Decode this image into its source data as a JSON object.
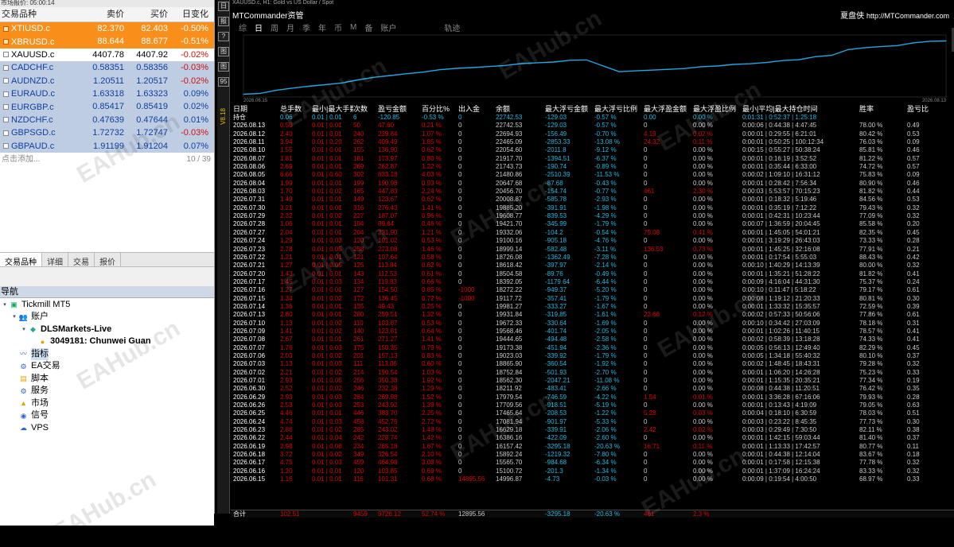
{
  "market_watch": {
    "title": "市场报价: 05:00:14",
    "headers": {
      "symbol": "交易品种",
      "bid": "卖价",
      "ask": "买价",
      "change": "日变化"
    },
    "rows": [
      {
        "symbol": "XTIUSD.c",
        "bid": "82.370",
        "ask": "82.403",
        "change": "-0.50%",
        "style": "orange"
      },
      {
        "symbol": "XBRUSD.c",
        "bid": "88.644",
        "ask": "88.677",
        "change": "-0.51%",
        "style": "orange"
      },
      {
        "symbol": "XAUUSD.c",
        "bid": "4407.78",
        "ask": "4407.92",
        "change": "-0.02%",
        "style": "white"
      },
      {
        "symbol": "CADCHF.c",
        "bid": "0.58351",
        "ask": "0.58356",
        "change": "-0.03%",
        "style": "blue"
      },
      {
        "symbol": "AUDNZD.c",
        "bid": "1.20511",
        "ask": "1.20517",
        "change": "-0.02%",
        "style": "blue"
      },
      {
        "symbol": "EURAUD.c",
        "bid": "1.63318",
        "ask": "1.63323",
        "change": "0.09%",
        "style": "blue"
      },
      {
        "symbol": "EURGBP.c",
        "bid": "0.85417",
        "ask": "0.85419",
        "change": "0.02%",
        "style": "blue"
      },
      {
        "symbol": "NZDCHF.c",
        "bid": "0.47639",
        "ask": "0.47644",
        "change": "0.01%",
        "style": "blue"
      },
      {
        "symbol": "GBPSGD.c",
        "bid": "1.72732",
        "ask": "1.72747",
        "change": "-0.03%",
        "style": "blue"
      },
      {
        "symbol": "GBPAUD.c",
        "bid": "1.91199",
        "ask": "1.91204",
        "change": "0.07%",
        "style": "blue"
      }
    ],
    "add_label": "点击添加...",
    "count": "10 / 39",
    "tabs": [
      "交易品种",
      "详细",
      "交易",
      "报价"
    ]
  },
  "navigator": {
    "title": "导航",
    "items": [
      {
        "label": "Tickmill MT5",
        "indent": 0,
        "icon": "terminal-icon",
        "bold": false
      },
      {
        "label": "账户",
        "indent": 1,
        "icon": "accounts-icon",
        "bold": false
      },
      {
        "label": "DLSMarkets-Live",
        "indent": 2,
        "icon": "server-icon",
        "bold": true
      },
      {
        "label": "3049181: Chunwei Guan",
        "indent": 3,
        "icon": "user-icon",
        "bold": true
      },
      {
        "label": "指标",
        "indent": 1,
        "icon": "indicators-icon",
        "bold": false,
        "selected": true
      },
      {
        "label": "EA交易",
        "indent": 1,
        "icon": "expert-advisor-icon",
        "bold": false
      },
      {
        "label": "脚本",
        "indent": 1,
        "icon": "scripts-icon",
        "bold": false
      },
      {
        "label": "服务",
        "indent": 1,
        "icon": "services-icon",
        "bold": false
      },
      {
        "label": "市场",
        "indent": 1,
        "icon": "market-icon",
        "bold": false
      },
      {
        "label": "信号",
        "indent": 1,
        "icon": "signals-icon",
        "bold": false
      },
      {
        "label": "VPS",
        "indent": 1,
        "icon": "vps-icon",
        "bold": false
      }
    ]
  },
  "chart_window": {
    "title": "XAUUSD.c, H1: Gold vs US Dollar / Spot",
    "app_name": "MTCommander资管",
    "brand": "夏盘侠",
    "brand_url": "http://MTCommander.com",
    "tabs": [
      "综",
      "日",
      "周",
      "月",
      "季",
      "年",
      "币",
      "M",
      "备",
      "账户"
    ],
    "active_tab": "日",
    "trail_label": "轨迹",
    "version_label": "V8.18",
    "axis_start": "2026.06.15",
    "axis_end": "2026.08.13",
    "toolbar_labels": [
      "日",
      "报",
      "?",
      "图",
      "图",
      "95"
    ]
  },
  "chart_data": {
    "type": "line",
    "title": "",
    "xlabel": "",
    "ylabel": "",
    "x": [
      "2026.06.15",
      "2026.06.16",
      "2026.06.17",
      "2026.06.18",
      "2026.06.19",
      "2026.06.22",
      "2026.06.23",
      "2026.06.24",
      "2026.06.25",
      "2026.06.26",
      "2026.06.29",
      "2026.06.30",
      "2026.07.01",
      "2026.07.02",
      "2026.07.03",
      "2026.07.06",
      "2026.07.07",
      "2026.07.08",
      "2026.07.09",
      "2026.07.10",
      "2026.07.13",
      "2026.07.14",
      "2026.07.15",
      "2026.07.16",
      "2026.07.17",
      "2026.07.20",
      "2026.07.21",
      "2026.07.22",
      "2026.07.23",
      "2026.07.24",
      "2026.07.27",
      "2026.07.28",
      "2026.07.29",
      "2026.07.30",
      "2026.07.31",
      "2026.08.03",
      "2026.08.04",
      "2026.08.05",
      "2026.08.06",
      "2026.08.07",
      "2026.08.10",
      "2026.08.11",
      "2026.08.12",
      "2026.08.13"
    ],
    "series": [
      {
        "values": [
          14996.87,
          15100.72,
          15565.7,
          15892.24,
          16157.42,
          16386.16,
          16629.18,
          17081.94,
          17465.64,
          17709.56,
          17979.54,
          18211.92,
          18562.3,
          18752.84,
          18865.9,
          19023.03,
          19173.38,
          19444.65,
          19568.46,
          19672.33,
          19931.84,
          19981.27,
          19117.72,
          18272.22,
          18392.05,
          18504.58,
          18618.42,
          18726.08,
          18999.14,
          19100.16,
          19332.06,
          19421.7,
          19608.77,
          19885.2,
          20008.87,
          20456.7,
          20647.68,
          21480.86,
          21743.73,
          21917.7,
          22054.6,
          22465.09,
          22694.93,
          22742.53
        ]
      }
    ],
    "color": "#22a8e0"
  },
  "table": {
    "headers": [
      "日期",
      "总手数",
      "最小|最大手数",
      "次数",
      "盈亏金额",
      "百分比%",
      "出入金",
      "余额",
      "最大浮亏金额",
      "最大浮亏比例",
      "最大浮盈金额",
      "最大浮盈比例",
      "最小|平均|最大持仓时间",
      "胜率",
      "盈亏比"
    ],
    "hold_row": [
      "持仓",
      "0.06",
      "0.01 | 0.01",
      "6",
      "-120.85",
      "-0.53 %",
      "0",
      "22742.53",
      "-129.03",
      "-0.57 %",
      "0.00",
      "0.00 %",
      "0:01:31 | 0:52:37 | 1:25:18",
      "",
      ""
    ],
    "rows": [
      [
        "2026.08.13",
        "0.50",
        "0.01 | 0.01",
        "50",
        "47.60",
        "0.21 %",
        "0",
        "22742.53",
        "-129.03",
        "-0.57 %",
        "0",
        "0.00 %",
        "0:00:06 | 0:44:38 | 4:47:45",
        "78.00 %",
        "0.49"
      ],
      [
        "2026.08.12",
        "2.40",
        "0.01 | 0.01",
        "240",
        "239.84",
        "1.07 %",
        "0",
        "22694.93",
        "-156.49",
        "-0.70 %",
        "4.19",
        "0.02 %",
        "0:00:01 | 0:29:55 | 6:21:01",
        "80.42 %",
        "0.53"
      ],
      [
        "2026.08.11",
        "3.94",
        "0.01 | 0.20",
        "262",
        "409.49",
        "1.85 %",
        "0",
        "22465.09",
        "-2853.33",
        "-13.08 %",
        "24.32",
        "0.11 %",
        "0:00:01 | 0:50:25 | 100:12:34",
        "76.03 %",
        "0.09"
      ],
      [
        "2026.08.10",
        "1.55",
        "0.01 | 0.01",
        "155",
        "136.90",
        "0.62 %",
        "0",
        "22054.60",
        "-2011.8",
        "-9.12 %",
        "0",
        "0.00 %",
        "0:00:15 | 0:55:27 | 50:38:24",
        "85.81 %",
        "0.46"
      ],
      [
        "2026.08.07",
        "1.81",
        "0.01 | 0.01",
        "181",
        "173.97",
        "0.80 %",
        "0",
        "21917.70",
        "-1394.51",
        "-6.37 %",
        "0",
        "0.00 %",
        "0:00:01 | 0:16:19 | 3:52:52",
        "81.22 %",
        "0.57"
      ],
      [
        "2026.08.06",
        "2.69",
        "0.01 | 0.01",
        "269",
        "262.87",
        "1.22 %",
        "0",
        "21743.73",
        "-190.74",
        "-0.89 %",
        "0",
        "0.00 %",
        "0:00:01 | 0:35:44 | 6:33:00",
        "74.72 %",
        "0.57"
      ],
      [
        "2026.08.05",
        "6.66",
        "0.01 | 0.60",
        "302",
        "833.18",
        "4.03 %",
        "0",
        "21480.86",
        "-2510.39",
        "-11.53 %",
        "0",
        "0.00 %",
        "0:00:02 | 1:09:10 | 16:31:12",
        "75.83 %",
        "0.09"
      ],
      [
        "2026.08.04",
        "1.99",
        "0.01 | 0.01",
        "199",
        "190.98",
        "0.93 %",
        "0",
        "20647.68",
        "-87.68",
        "-0.43 %",
        "0",
        "0.00 %",
        "0:00:01 | 0:28:42 | 7:56:34",
        "80.90 %",
        "0.46"
      ],
      [
        "2026.08.03",
        "1.70",
        "0.01 | 0.02",
        "165",
        "447.83",
        "2.24 %",
        "0",
        "20456.70",
        "-154.74",
        "-0.77 %",
        "461",
        "2.30 %",
        "0:00:03 | 5:53:57 | 70:15:23",
        "81.82 %",
        "0.44"
      ],
      [
        "2026.07.31",
        "1.49",
        "0.01 | 0.01",
        "149",
        "123.67",
        "0.62 %",
        "0",
        "20008.87",
        "-585.78",
        "-2.93 %",
        "0",
        "0.00 %",
        "0:00:01 | 0:18:32 | 5:19:46",
        "84.56 %",
        "0.53"
      ],
      [
        "2026.07.30",
        "3.21",
        "0.01 | 0.01",
        "316",
        "276.43",
        "1.41 %",
        "0",
        "19885.20",
        "-391.91",
        "-1.98 %",
        "0",
        "0.00 %",
        "0:00:01 | 0:35:19 | 7:12:22",
        "79.43 %",
        "0.32"
      ],
      [
        "2026.07.29",
        "2.32",
        "0.01 | 0.02",
        "227",
        "187.07",
        "0.96 %",
        "0",
        "19608.77",
        "-839.53",
        "-4.29 %",
        "0",
        "0.00 %",
        "0:00:01 | 0:42:31 | 10:23:44",
        "77.09 %",
        "0.32"
      ],
      [
        "2026.07.28",
        "1.06",
        "0.01 | 0.01",
        "104",
        "89.64",
        "0.46 %",
        "0",
        "19421.70",
        "-345.99",
        "-1.79 %",
        "0",
        "0.00 %",
        "0:00:07 | 1:36:59 | 20:04:45",
        "85.58 %",
        "0.20"
      ],
      [
        "2026.07.27",
        "2.04",
        "0.01 | 0.01",
        "204",
        "231.90",
        "1.21 %",
        "0",
        "19332.06",
        "-104.2",
        "-0.54 %",
        "79.08",
        "0.41 %",
        "0:00:01 | 1:45:05 | 54:01:21",
        "82.35 %",
        "0.45"
      ],
      [
        "2026.07.24",
        "1.29",
        "0.01 | 0.03",
        "120",
        "101.02",
        "0.53 %",
        "0",
        "19100.16",
        "-905.18",
        "-4.76 %",
        "0",
        "0.00 %",
        "0:00:01 | 3:19:29 | 26:43:03",
        "73.33 %",
        "0.28"
      ],
      [
        "2026.07.23",
        "2.78",
        "0.01 | 0.05",
        "258",
        "273.08",
        "1.46 %",
        "0",
        "18999.14",
        "-582.48",
        "-3.11 %",
        "136.53",
        "0.73 %",
        "0:00:01 | 1:45:25 | 32:16:08",
        "77.91 %",
        "0.21"
      ],
      [
        "2026.07.22",
        "1.21",
        "0.01 | 0.01",
        "121",
        "107.64",
        "0.58 %",
        "0",
        "18726.08",
        "-1362.49",
        "-7.28 %",
        "0",
        "0.00 %",
        "0:00:01 | 0:17:54 | 5:55:03",
        "88.43 %",
        "0.42"
      ],
      [
        "2026.07.21",
        "1.27",
        "0.01 | 0.05",
        "125",
        "113.84",
        "0.62 %",
        "0",
        "18618.42",
        "-397.97",
        "-2.14 %",
        "0",
        "0.00 %",
        "0:00:10 | 1:40:29 | 14:13:39",
        "80.00 %",
        "0.32"
      ],
      [
        "2026.07.20",
        "1.43",
        "0.01 | 0.01",
        "143",
        "112.53",
        "0.61 %",
        "0",
        "18504.58",
        "-89.76",
        "-0.49 %",
        "0",
        "0.00 %",
        "0:00:01 | 1:35:21 | 51:28:22",
        "81.82 %",
        "0.41"
      ],
      [
        "2026.07.17",
        "1.45",
        "0.01 | 0.03",
        "134",
        "119.83",
        "0.66 %",
        "0",
        "18392.05",
        "-1179.64",
        "-6.44 %",
        "0",
        "0.00 %",
        "0:00:09 | 4:16:04 | 44:31:30",
        "75.37 %",
        "0.24"
      ],
      [
        "2026.07.16",
        "1.27",
        "0.01 | 0.01",
        "127",
        "154.50",
        "0.85 %",
        "-1000",
        "18272.22",
        "-949.37",
        "-5.20 %",
        "0",
        "0.00 %",
        "0:00:10 | 0:11:47 | 5:18:22",
        "79.17 %",
        "0.61"
      ],
      [
        "2026.07.15",
        "1.34",
        "0.01 | 0.02",
        "172",
        "136.45",
        "0.72 %",
        "-1000",
        "19117.72",
        "-357.41",
        "-1.79 %",
        "0",
        "0.00 %",
        "0:00:08 | 1:19:12 | 21:20:33",
        "80.81 %",
        "0.30"
      ],
      [
        "2026.07.14",
        "1.36",
        "0.01 | 0.01",
        "135",
        "49.43",
        "0.25 %",
        "0",
        "19981.27",
        "-333.27",
        "-1.67 %",
        "0",
        "0.00 %",
        "0:00:01 | 1:33:32 | 15:35:57",
        "72.59 %",
        "0.39"
      ],
      [
        "2026.07.13",
        "2.80",
        "0.01 | 0.01",
        "280",
        "259.51",
        "1.32 %",
        "0",
        "19931.84",
        "-319.85",
        "-1.61 %",
        "23.68",
        "0.12 %",
        "0:00:02 | 0:57:33 | 50:56:06",
        "77.86 %",
        "0.61"
      ],
      [
        "2026.07.10",
        "1.13",
        "0.01 | 0.02",
        "110",
        "103.87",
        "0.53 %",
        "0",
        "19672.33",
        "-330.64",
        "-1.69 %",
        "0",
        "0.00 %",
        "0:00:10 | 0:34:42 | 27:03:09",
        "78.18 %",
        "0.31"
      ],
      [
        "2026.07.09",
        "1.41",
        "0.01 | 0.02",
        "140",
        "123.81",
        "0.64 %",
        "0",
        "19568.46",
        "-401.74",
        "-2.05 %",
        "0",
        "0.00 %",
        "0:00:01 | 1:02:26 | 11:40:15",
        "78.57 %",
        "0.41"
      ],
      [
        "2026.07.08",
        "2.67",
        "0.01 | 0.01",
        "261",
        "271.27",
        "1.41 %",
        "0",
        "19444.65",
        "-494.48",
        "-2.58 %",
        "0",
        "0.00 %",
        "0:00:02 | 0:58:39 | 13:18:28",
        "74.33 %",
        "0.41"
      ],
      [
        "2026.07.07",
        "1.76",
        "0.01 | 0.03",
        "175",
        "150.35",
        "0.79 %",
        "0",
        "19173.38",
        "-451.94",
        "-2.36 %",
        "0",
        "0.00 %",
        "0:00:05 | 0:56:13 | 12:49:40",
        "82.29 %",
        "0.45"
      ],
      [
        "2026.07.06",
        "2.03",
        "0.01 | 0.02",
        "201",
        "157.13",
        "0.83 %",
        "0",
        "19023.03",
        "-339.92",
        "-1.79 %",
        "0",
        "0.00 %",
        "0:00:05 | 1:34:18 | 55:40:32",
        "80.10 %",
        "0.37"
      ],
      [
        "2026.07.03",
        "1.13",
        "0.01 | 0.03",
        "111",
        "113.06",
        "0.60 %",
        "0",
        "18865.90",
        "-360.54",
        "-1.92 %",
        "0",
        "0.00 %",
        "0:00:02 | 1:48:45 | 18:43:31",
        "79.28 %",
        "0.32"
      ],
      [
        "2026.07.02",
        "2.21",
        "0.01 | 0.02",
        "214",
        "190.54",
        "1.03 %",
        "0",
        "18752.84",
        "-501.93",
        "-2.70 %",
        "0",
        "0.00 %",
        "0:00:01 | 1:06:20 | 14:26:28",
        "75.23 %",
        "0.33"
      ],
      [
        "2026.07.01",
        "2.93",
        "0.01 | 0.05",
        "256",
        "350.38",
        "1.92 %",
        "0",
        "18562.30",
        "-2047.21",
        "-11.08 %",
        "0",
        "0.00 %",
        "0:00:01 | 1:15:35 | 20:35:21",
        "77.34 %",
        "0.19"
      ],
      [
        "2026.06.30",
        "2.52",
        "0.01 | 0.02",
        "246",
        "232.38",
        "1.29 %",
        "0",
        "18211.92",
        "-483.41",
        "-2.66 %",
        "0",
        "0.00 %",
        "0:00:08 | 0:44:38 | 11:20:51",
        "76.42 %",
        "0.35"
      ],
      [
        "2026.06.29",
        "2.93",
        "0.01 | 0.03",
        "284",
        "269.98",
        "1.52 %",
        "0",
        "17979.54",
        "-746.59",
        "-4.22 %",
        "1.54",
        "0.01 %",
        "0:00:01 | 3:36:28 | 67:16:06",
        "79.93 %",
        "0.28"
      ],
      [
        "2026.06.26",
        "2.53",
        "0.01 | 0.03",
        "253",
        "243.92",
        "1.39 %",
        "0",
        "17709.56",
        "-918.51",
        "-5.19 %",
        "0",
        "0.00 %",
        "0:00:01 | 0:13:43 | 4:19:09",
        "79.05 %",
        "0.63"
      ],
      [
        "2026.06.25",
        "4.46",
        "0.01 | 0.01",
        "446",
        "383.70",
        "2.25 %",
        "0",
        "17465.64",
        "-208.53",
        "-1.22 %",
        "5.28",
        "0.03 %",
        "0:00:04 | 0:18:10 | 6:30:59",
        "78.03 %",
        "0.51"
      ],
      [
        "2026.06.24",
        "4.74",
        "0.01 | 0.03",
        "458",
        "452.76",
        "2.72 %",
        "0",
        "17081.94",
        "-901.97",
        "-5.33 %",
        "0",
        "0.00 %",
        "0:00:03 | 0:23:22 | 8:45:35",
        "77.73 %",
        "0.30"
      ],
      [
        "2026.06.23",
        "2.86",
        "0.01 | 0.02",
        "285",
        "243.02",
        "1.48 %",
        "0",
        "16629.18",
        "-339.91",
        "-2.06 %",
        "2.42",
        "0.02 %",
        "0:00:03 | 0:29:49 | 7:30:50",
        "82.11 %",
        "0.38"
      ],
      [
        "2026.06.22",
        "2.44",
        "0.01 | 0.04",
        "242",
        "228.74",
        "1.42 %",
        "0",
        "16386.16",
        "-422.09",
        "-2.60 %",
        "0",
        "0.00 %",
        "0:00:01 | 1:42:15 | 59:03:44",
        "81.40 %",
        "0.37"
      ],
      [
        "2026.06.19",
        "2.98",
        "0.01 | 0.08",
        "234",
        "265.18",
        "1.67 %",
        "0",
        "16157.42",
        "-3295.18",
        "-20.63 %",
        "16.71",
        "0.11 %",
        "0:00:01 | 1:13:33 | 17:42:57",
        "80.77 %",
        "0.11"
      ],
      [
        "2026.06.18",
        "3.72",
        "0.01 | 0.02",
        "349",
        "326.54",
        "2.10 %",
        "0",
        "15892.24",
        "-1219.32",
        "-7.80 %",
        "0",
        "0.00 %",
        "0:00:01 | 0:44:38 | 12:14:04",
        "83.67 %",
        "0.18"
      ],
      [
        "2026.06.17",
        "4.75",
        "0.01 | 0.03",
        "459",
        "464.98",
        "3.08 %",
        "0",
        "15565.70",
        "-984.68",
        "-6.34 %",
        "0",
        "0.00 %",
        "0:00:01 | 0:17:58 | 12:15:38",
        "77.78 %",
        "0.32"
      ],
      [
        "2026.06.16",
        "1.20",
        "0.01 | 0.01",
        "120",
        "103.85",
        "0.69 %",
        "0",
        "15100.72",
        "-201.3",
        "-1.34 %",
        "0",
        "0.00 %",
        "0:00:01 | 1:37:09 | 16:24:24",
        "83.33 %",
        "0.32"
      ],
      [
        "2026.06.15",
        "1.16",
        "0.01 | 0.01",
        "116",
        "101.31",
        "0.68 %",
        "14895.56",
        "14996.87",
        "-4.73",
        "-0.03 %",
        "0",
        "0.00 %",
        "0:00:09 | 0:19:54 | 4:00:50",
        "68.97 %",
        "0.33"
      ]
    ],
    "total_row": [
      "合计",
      "102.51",
      "",
      "9459",
      "9726.12",
      "52.74 %",
      "12895.56",
      "",
      "-3295.18",
      "-20.63 %",
      "461",
      "2.3 %",
      "",
      "",
      ""
    ]
  },
  "watermark": "EAHub.cn"
}
